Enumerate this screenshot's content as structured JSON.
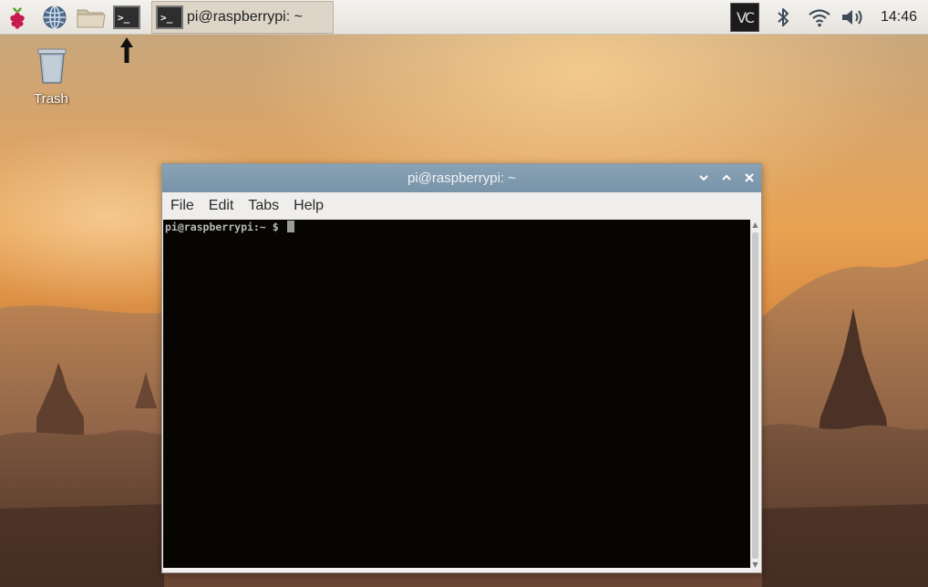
{
  "panel": {
    "menu_icon": "raspberry-icon",
    "launchers": [
      {
        "name": "web-browser",
        "icon": "globe-icon"
      },
      {
        "name": "file-manager",
        "icon": "folder-icon"
      },
      {
        "name": "terminal",
        "icon": "terminal-icon",
        "glyph": ">_"
      }
    ],
    "task": {
      "glyph": ">_",
      "label": "pi@raspberrypi: ~"
    },
    "tray": [
      "vnc-icon",
      "bluetooth-icon",
      "wifi-icon",
      "volume-icon"
    ],
    "vnc_label": "VC",
    "clock": "14:46"
  },
  "desktop": {
    "icons": [
      {
        "label": "Trash",
        "icon": "trash-icon"
      }
    ]
  },
  "window": {
    "title": "pi@raspberrypi: ~",
    "menu": [
      "File",
      "Edit",
      "Tabs",
      "Help"
    ],
    "prompt": "pi@raspberrypi:~ $ "
  },
  "colors": {
    "titlebar": "#7f99ad",
    "terminal_bg": "#060502",
    "panel_bg": "#ebe8e2"
  }
}
